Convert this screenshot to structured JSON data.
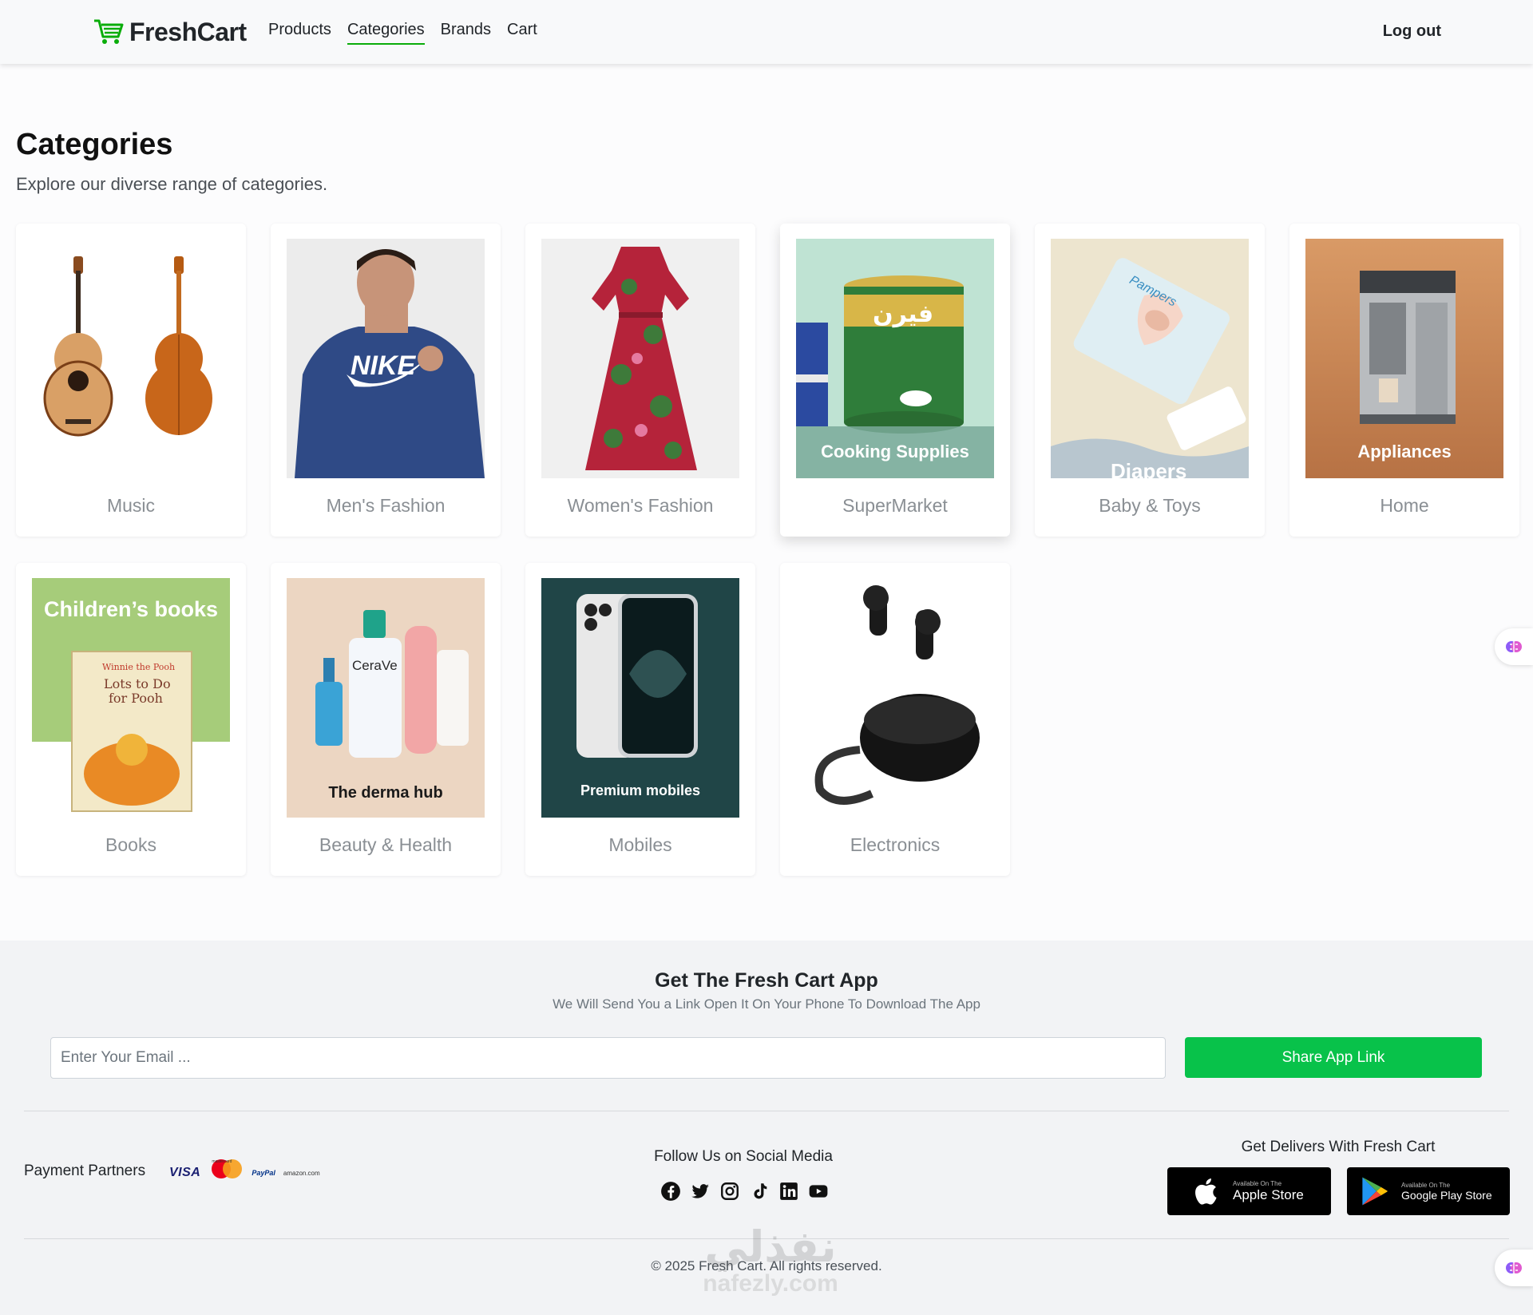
{
  "navbar": {
    "brand": "FreshCart",
    "links": [
      "Products",
      "Categories",
      "Brands",
      "Cart"
    ],
    "active_link": "Categories",
    "logout": "Log out"
  },
  "page": {
    "title": "Categories",
    "subtitle": "Explore our diverse range of categories."
  },
  "categories": [
    {
      "name": "Music",
      "image_text": ""
    },
    {
      "name": "Men's Fashion",
      "image_text": ""
    },
    {
      "name": "Women's Fashion",
      "image_text": ""
    },
    {
      "name": "SuperMarket",
      "image_text": "Cooking Supplies"
    },
    {
      "name": "Baby & Toys",
      "image_text": "Diapers"
    },
    {
      "name": "Home",
      "image_text": "Appliances"
    },
    {
      "name": "Books",
      "image_text": "Children’s books"
    },
    {
      "name": "Beauty & Health",
      "image_text": "The derma hub"
    },
    {
      "name": "Mobiles",
      "image_text": "Premium mobiles"
    },
    {
      "name": "Electronics",
      "image_text": ""
    }
  ],
  "footer": {
    "app_title": "Get The Fresh Cart App",
    "app_subtitle": "We Will Send You a Link Open It On Your Phone To Download The App",
    "email_placeholder": "Enter Your Email ...",
    "share_button": "Share App Link",
    "payment_label": "Payment Partners",
    "payment_partners": [
      "VISA",
      "mastercard",
      "PayPal",
      "amazon.com"
    ],
    "social_label": "Follow Us on Social Media",
    "social_icons": [
      "facebook-icon",
      "twitter-icon",
      "instagram-icon",
      "tiktok-icon",
      "linkedin-icon",
      "youtube-icon"
    ],
    "deliver_label": "Get Delivers With Fresh Cart",
    "apple_store": {
      "small": "Available On The",
      "big": "Apple Store"
    },
    "google_store": {
      "small": "Available On The",
      "big": "Google Play Store"
    },
    "copyright": "© 2025 Fresh Cart. All rights reserved."
  },
  "watermark": {
    "arabic": "نفذلي",
    "latin": "nafezly.com"
  },
  "colors": {
    "accent": "#0aad0a",
    "share_button": "#08c24a"
  }
}
